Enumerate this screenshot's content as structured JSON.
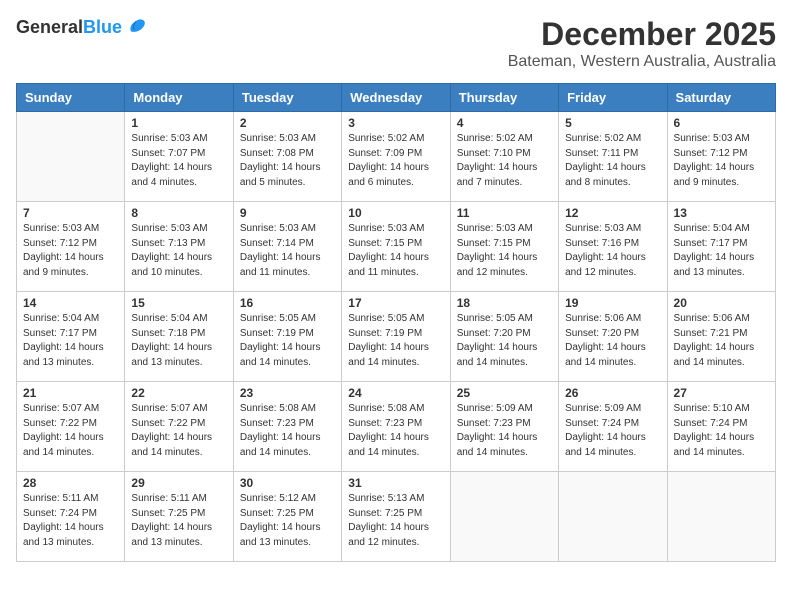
{
  "header": {
    "logo_general": "General",
    "logo_blue": "Blue",
    "month_title": "December 2025",
    "location": "Bateman, Western Australia, Australia"
  },
  "weekdays": [
    "Sunday",
    "Monday",
    "Tuesday",
    "Wednesday",
    "Thursday",
    "Friday",
    "Saturday"
  ],
  "weeks": [
    [
      {
        "day": "",
        "sunrise": "",
        "sunset": "",
        "daylight": ""
      },
      {
        "day": "1",
        "sunrise": "Sunrise: 5:03 AM",
        "sunset": "Sunset: 7:07 PM",
        "daylight": "Daylight: 14 hours and 4 minutes."
      },
      {
        "day": "2",
        "sunrise": "Sunrise: 5:03 AM",
        "sunset": "Sunset: 7:08 PM",
        "daylight": "Daylight: 14 hours and 5 minutes."
      },
      {
        "day": "3",
        "sunrise": "Sunrise: 5:02 AM",
        "sunset": "Sunset: 7:09 PM",
        "daylight": "Daylight: 14 hours and 6 minutes."
      },
      {
        "day": "4",
        "sunrise": "Sunrise: 5:02 AM",
        "sunset": "Sunset: 7:10 PM",
        "daylight": "Daylight: 14 hours and 7 minutes."
      },
      {
        "day": "5",
        "sunrise": "Sunrise: 5:02 AM",
        "sunset": "Sunset: 7:11 PM",
        "daylight": "Daylight: 14 hours and 8 minutes."
      },
      {
        "day": "6",
        "sunrise": "Sunrise: 5:03 AM",
        "sunset": "Sunset: 7:12 PM",
        "daylight": "Daylight: 14 hours and 9 minutes."
      }
    ],
    [
      {
        "day": "7",
        "sunrise": "Sunrise: 5:03 AM",
        "sunset": "Sunset: 7:12 PM",
        "daylight": "Daylight: 14 hours and 9 minutes."
      },
      {
        "day": "8",
        "sunrise": "Sunrise: 5:03 AM",
        "sunset": "Sunset: 7:13 PM",
        "daylight": "Daylight: 14 hours and 10 minutes."
      },
      {
        "day": "9",
        "sunrise": "Sunrise: 5:03 AM",
        "sunset": "Sunset: 7:14 PM",
        "daylight": "Daylight: 14 hours and 11 minutes."
      },
      {
        "day": "10",
        "sunrise": "Sunrise: 5:03 AM",
        "sunset": "Sunset: 7:15 PM",
        "daylight": "Daylight: 14 hours and 11 minutes."
      },
      {
        "day": "11",
        "sunrise": "Sunrise: 5:03 AM",
        "sunset": "Sunset: 7:15 PM",
        "daylight": "Daylight: 14 hours and 12 minutes."
      },
      {
        "day": "12",
        "sunrise": "Sunrise: 5:03 AM",
        "sunset": "Sunset: 7:16 PM",
        "daylight": "Daylight: 14 hours and 12 minutes."
      },
      {
        "day": "13",
        "sunrise": "Sunrise: 5:04 AM",
        "sunset": "Sunset: 7:17 PM",
        "daylight": "Daylight: 14 hours and 13 minutes."
      }
    ],
    [
      {
        "day": "14",
        "sunrise": "Sunrise: 5:04 AM",
        "sunset": "Sunset: 7:17 PM",
        "daylight": "Daylight: 14 hours and 13 minutes."
      },
      {
        "day": "15",
        "sunrise": "Sunrise: 5:04 AM",
        "sunset": "Sunset: 7:18 PM",
        "daylight": "Daylight: 14 hours and 13 minutes."
      },
      {
        "day": "16",
        "sunrise": "Sunrise: 5:05 AM",
        "sunset": "Sunset: 7:19 PM",
        "daylight": "Daylight: 14 hours and 14 minutes."
      },
      {
        "day": "17",
        "sunrise": "Sunrise: 5:05 AM",
        "sunset": "Sunset: 7:19 PM",
        "daylight": "Daylight: 14 hours and 14 minutes."
      },
      {
        "day": "18",
        "sunrise": "Sunrise: 5:05 AM",
        "sunset": "Sunset: 7:20 PM",
        "daylight": "Daylight: 14 hours and 14 minutes."
      },
      {
        "day": "19",
        "sunrise": "Sunrise: 5:06 AM",
        "sunset": "Sunset: 7:20 PM",
        "daylight": "Daylight: 14 hours and 14 minutes."
      },
      {
        "day": "20",
        "sunrise": "Sunrise: 5:06 AM",
        "sunset": "Sunset: 7:21 PM",
        "daylight": "Daylight: 14 hours and 14 minutes."
      }
    ],
    [
      {
        "day": "21",
        "sunrise": "Sunrise: 5:07 AM",
        "sunset": "Sunset: 7:22 PM",
        "daylight": "Daylight: 14 hours and 14 minutes."
      },
      {
        "day": "22",
        "sunrise": "Sunrise: 5:07 AM",
        "sunset": "Sunset: 7:22 PM",
        "daylight": "Daylight: 14 hours and 14 minutes."
      },
      {
        "day": "23",
        "sunrise": "Sunrise: 5:08 AM",
        "sunset": "Sunset: 7:23 PM",
        "daylight": "Daylight: 14 hours and 14 minutes."
      },
      {
        "day": "24",
        "sunrise": "Sunrise: 5:08 AM",
        "sunset": "Sunset: 7:23 PM",
        "daylight": "Daylight: 14 hours and 14 minutes."
      },
      {
        "day": "25",
        "sunrise": "Sunrise: 5:09 AM",
        "sunset": "Sunset: 7:23 PM",
        "daylight": "Daylight: 14 hours and 14 minutes."
      },
      {
        "day": "26",
        "sunrise": "Sunrise: 5:09 AM",
        "sunset": "Sunset: 7:24 PM",
        "daylight": "Daylight: 14 hours and 14 minutes."
      },
      {
        "day": "27",
        "sunrise": "Sunrise: 5:10 AM",
        "sunset": "Sunset: 7:24 PM",
        "daylight": "Daylight: 14 hours and 14 minutes."
      }
    ],
    [
      {
        "day": "28",
        "sunrise": "Sunrise: 5:11 AM",
        "sunset": "Sunset: 7:24 PM",
        "daylight": "Daylight: 14 hours and 13 minutes."
      },
      {
        "day": "29",
        "sunrise": "Sunrise: 5:11 AM",
        "sunset": "Sunset: 7:25 PM",
        "daylight": "Daylight: 14 hours and 13 minutes."
      },
      {
        "day": "30",
        "sunrise": "Sunrise: 5:12 AM",
        "sunset": "Sunset: 7:25 PM",
        "daylight": "Daylight: 14 hours and 13 minutes."
      },
      {
        "day": "31",
        "sunrise": "Sunrise: 5:13 AM",
        "sunset": "Sunset: 7:25 PM",
        "daylight": "Daylight: 14 hours and 12 minutes."
      },
      {
        "day": "",
        "sunrise": "",
        "sunset": "",
        "daylight": ""
      },
      {
        "day": "",
        "sunrise": "",
        "sunset": "",
        "daylight": ""
      },
      {
        "day": "",
        "sunrise": "",
        "sunset": "",
        "daylight": ""
      }
    ]
  ]
}
